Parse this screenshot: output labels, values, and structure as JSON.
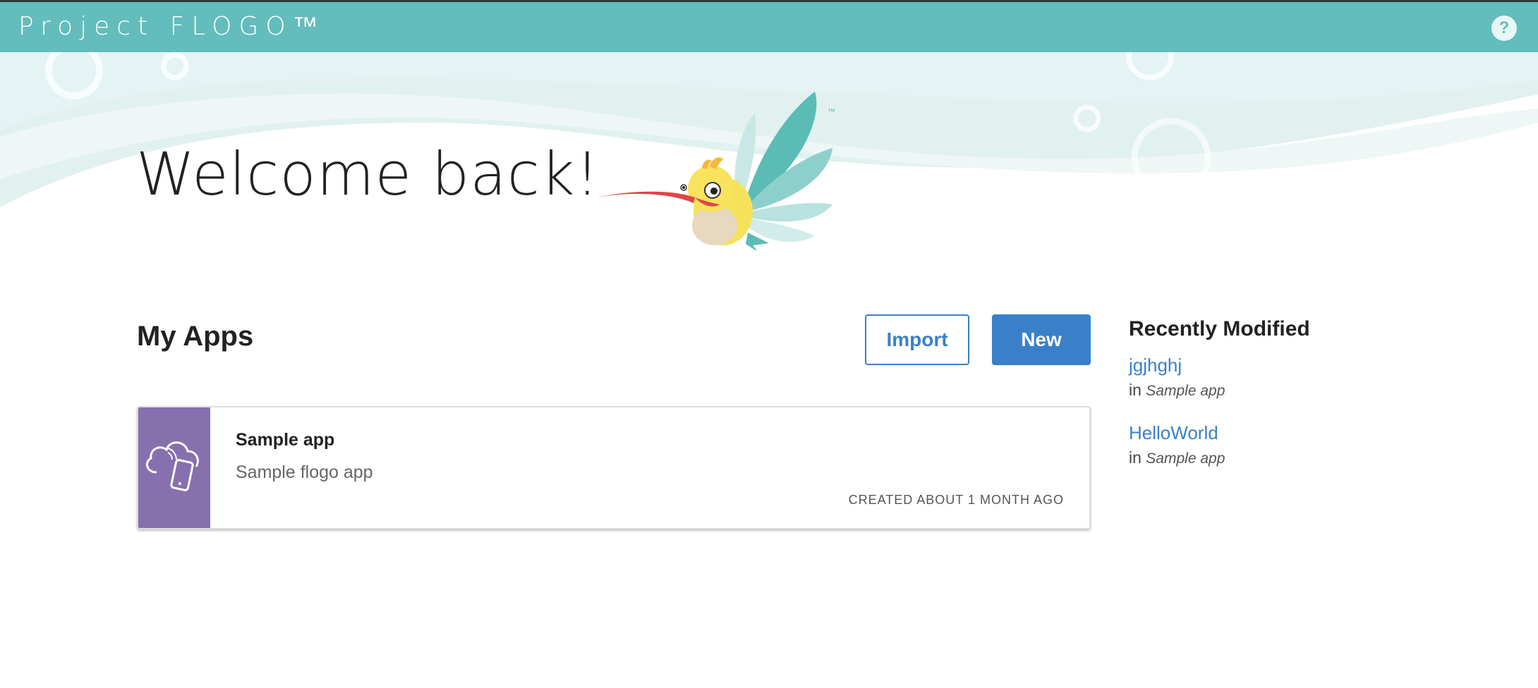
{
  "header": {
    "brand": "Project FLOGO™",
    "help_label": "?"
  },
  "hero": {
    "welcome": "Welcome back!",
    "mascot_tm": "™"
  },
  "apps_section": {
    "title": "My Apps",
    "import_label": "Import",
    "new_label": "New",
    "apps": [
      {
        "name": "Sample app",
        "description": "Sample flogo app",
        "created": "CREATED ABOUT 1 MONTH AGO",
        "icon": "cloud-phone-icon"
      }
    ]
  },
  "recent": {
    "title": "Recently Modified",
    "items": [
      {
        "name": "jgjhghj",
        "prefix": "in",
        "app": "Sample app"
      },
      {
        "name": "HelloWorld",
        "prefix": "in",
        "app": "Sample app"
      }
    ]
  },
  "colors": {
    "topbar": "#62bdbc",
    "accent": "#3a80c9",
    "app_icon_bg": "#8670ae"
  }
}
